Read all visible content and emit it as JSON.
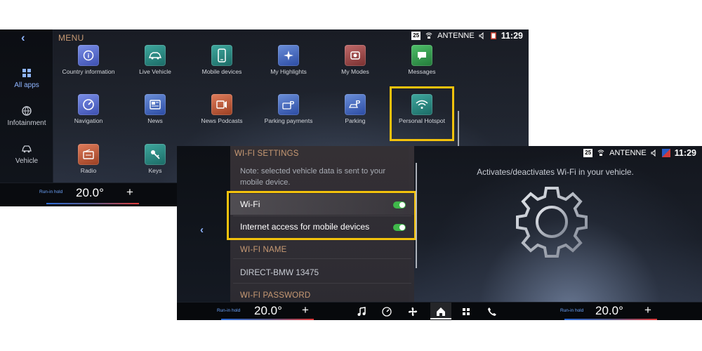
{
  "screen1": {
    "header_title": "MENU",
    "status": {
      "badge": "25",
      "radio": "ANTENNE",
      "time": "11:29"
    },
    "sidebar": [
      {
        "label": "All apps",
        "icon": "grid-icon",
        "active": true
      },
      {
        "label": "Infotainment",
        "icon": "globe-icon",
        "active": false
      },
      {
        "label": "Vehicle",
        "icon": "car-icon",
        "active": false
      }
    ],
    "apps_row1": [
      "Country information",
      "Live Vehicle",
      "Mobile devices",
      "My Highlights",
      "My Modes",
      "Messages"
    ],
    "apps_row2": [
      "Navigation",
      "News",
      "News Podcasts",
      "Parking payments",
      "Parking",
      "Personal Hotspot"
    ],
    "apps_row3": [
      "Radio",
      "Keys"
    ],
    "climate": {
      "label": "Run-in hold",
      "temp": "20.0°",
      "plus": "+"
    }
  },
  "screen2": {
    "section_title": "WI-FI SETTINGS",
    "note": "Note: selected vehicle data is sent to your mobile device.",
    "toggles": [
      {
        "label": "Wi-Fi",
        "on": true
      },
      {
        "label": "Internet access for mobile devices",
        "on": true
      }
    ],
    "name_header": "WI-FI NAME",
    "name_value": "DIRECT-BMW 13475",
    "password_header": "WI-FI PASSWORD",
    "description": "Activates/deactivates Wi-Fi in your vehicle.",
    "status": {
      "badge": "25",
      "radio": "ANTENNE",
      "time": "11:29"
    },
    "climate_left": {
      "label": "Run-in hold",
      "temp": "20.0°",
      "plus": "+"
    },
    "climate_right": {
      "label": "Run-in hold",
      "temp": "20.0°",
      "plus": "+"
    },
    "dock_icons": [
      "music-icon",
      "navigation-icon",
      "fan-icon",
      "home-icon",
      "apps-grid-icon",
      "phone-icon"
    ]
  },
  "colors": {
    "accent_blue": "#8fb4ff",
    "highlight_yellow": "#f3c20c",
    "section_header": "#c89a74",
    "toggle_green": "#3fb84a"
  }
}
